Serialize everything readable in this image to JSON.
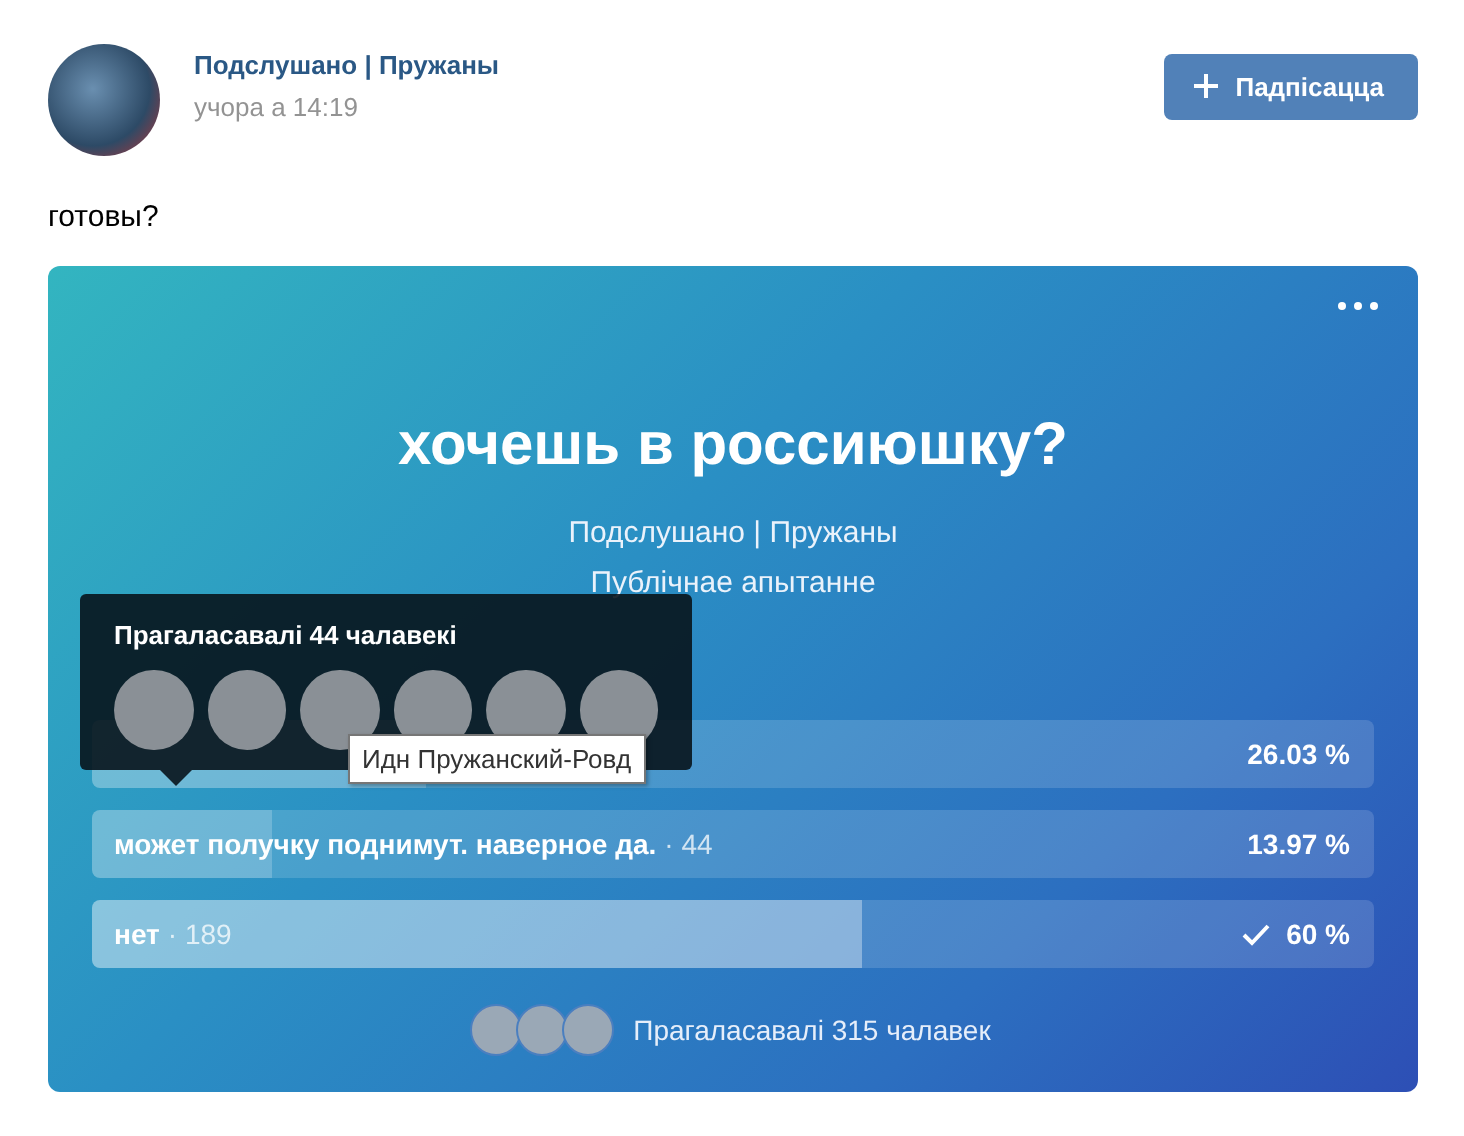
{
  "post": {
    "author": "Подслушано | Пружаны",
    "time": "учора а 14:19",
    "subscribe_button": "Падпісацца",
    "text": "готовы?"
  },
  "poll": {
    "title": "хочешь в россиюшку?",
    "author": "Подслушано | Пружаны",
    "type": "Публічнае апытанне",
    "options": [
      {
        "percent": "26.03 %",
        "level": 0.2603,
        "selected": false
      },
      {
        "label": "может получку поднимут. наверное да.",
        "count": "· 44",
        "percent": "13.97 %",
        "level": 0.1397,
        "selected": false
      },
      {
        "label": "нет",
        "count": "· 189",
        "percent": "60 %",
        "level": 0.6,
        "selected": true
      }
    ],
    "voters_summary": "Прагаласавалі 315 чалавек",
    "voters_popup": {
      "title": "Прагаласавалі 44 чалавекі",
      "tooltip": "Идн Пружанский-Ровд"
    }
  }
}
